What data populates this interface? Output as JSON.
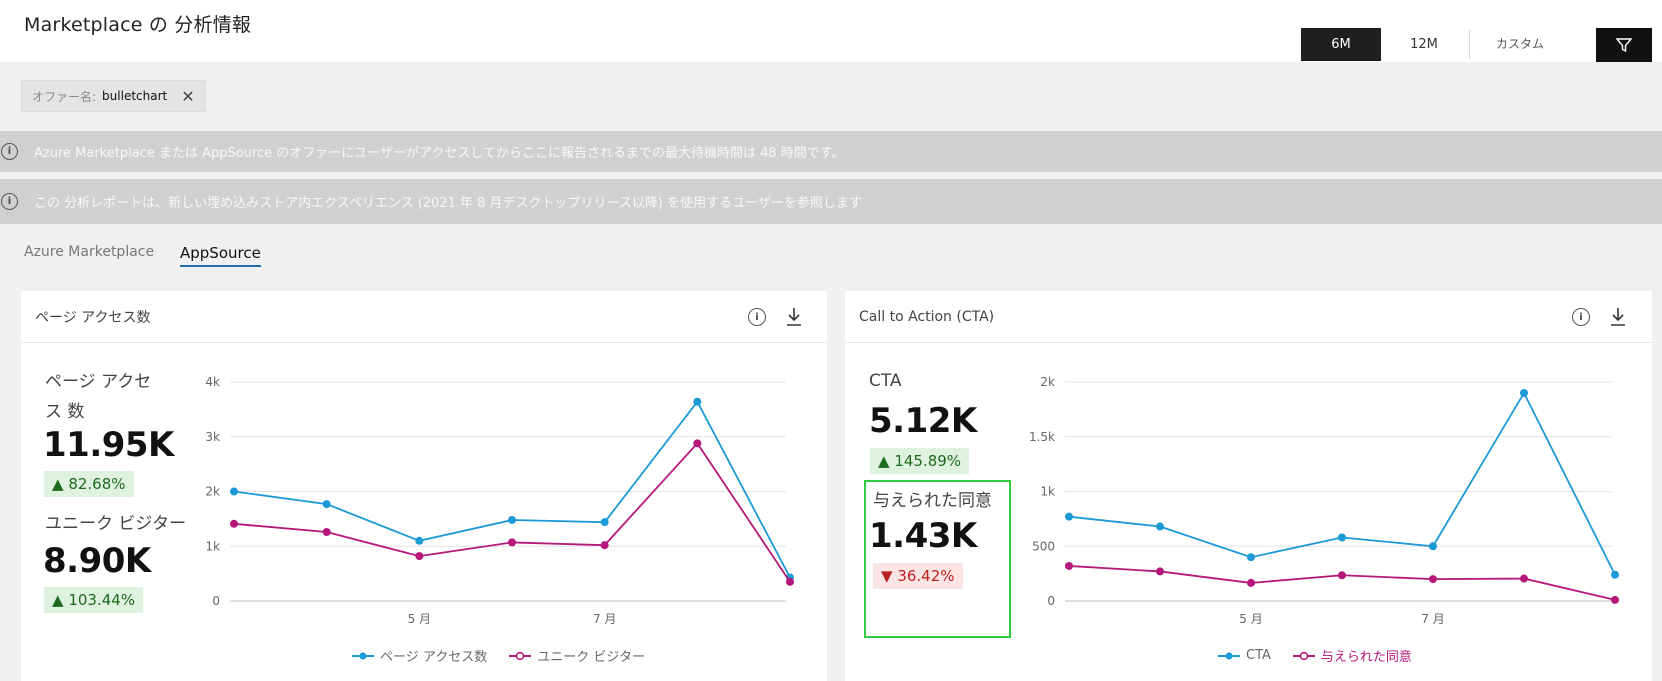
{
  "header": {
    "title": "Marketplace の 分析情報",
    "ranges": [
      "6M",
      "12M",
      "カスタム"
    ],
    "selected_range": "6M"
  },
  "filter_chip": {
    "key": "オファー名:",
    "value": "bulletchart"
  },
  "banners": [
    "Azure Marketplace または AppSource のオファーにユーザーがアクセスしてからここに報告されるまでの最大待機時間は 48 時間です。",
    "この 分析レポートは、新しい埋め込みストア内エクスペリエンス (2021 年 8 月デスクトップリリース以降) を使用するユーザーを参照します"
  ],
  "tabs": {
    "azure": "Azure Marketplace",
    "appsource": "AppSource",
    "active": "AppSource"
  },
  "colors": {
    "series_blue": "#1b9ad6",
    "series_magenta": "#b5177a",
    "badge_up": "#dff1df",
    "badge_down": "#fbe4e4",
    "highlight": "#2ecc40"
  },
  "card_pageviews": {
    "title": "ページ アクセス数",
    "kpi1_label": "ページ アクセス 数",
    "kpi1_value": "11.95K",
    "kpi1_change": "82.68%",
    "kpi2_label": "ユニーク ビジター",
    "kpi2_value": "8.90K",
    "kpi2_change": "103.44%"
  },
  "card_cta": {
    "title": "Call to Action (CTA)",
    "kpi1_label": "CTA",
    "kpi1_value": "5.12K",
    "kpi1_change": "145.89%",
    "kpi2_label": "与えられた同意",
    "kpi2_value": "1.43K",
    "kpi2_change": "36.42%"
  },
  "chart_data": [
    {
      "type": "line",
      "x_ticks": [
        "5 月",
        "7 月"
      ],
      "y_ticks": [
        "0",
        "1k",
        "2k",
        "3k",
        "4k"
      ],
      "ylim": [
        0,
        4000
      ],
      "series": [
        {
          "name": "ページ アクセス数",
          "color": "#1b9ad6",
          "values": [
            2000,
            1770,
            1100,
            1480,
            1440,
            3640,
            430
          ]
        },
        {
          "name": "ユニーク ビジター",
          "color": "#b5177a",
          "values": [
            1410,
            1260,
            820,
            1070,
            1020,
            2880,
            350
          ]
        }
      ],
      "legend_placement": "bottom"
    },
    {
      "type": "line",
      "x_ticks": [
        "5 月",
        "7 月"
      ],
      "y_ticks": [
        "0",
        "500",
        "1k",
        "1.5k",
        "2k"
      ],
      "ylim": [
        0,
        2000
      ],
      "series": [
        {
          "name": "CTA",
          "color": "#1b9ad6",
          "values": [
            770,
            680,
            400,
            580,
            500,
            1900,
            240
          ]
        },
        {
          "name": "与えられた同意",
          "color": "#b5177a",
          "values": [
            320,
            270,
            165,
            235,
            200,
            205,
            10
          ]
        }
      ],
      "legend_placement": "bottom"
    }
  ]
}
